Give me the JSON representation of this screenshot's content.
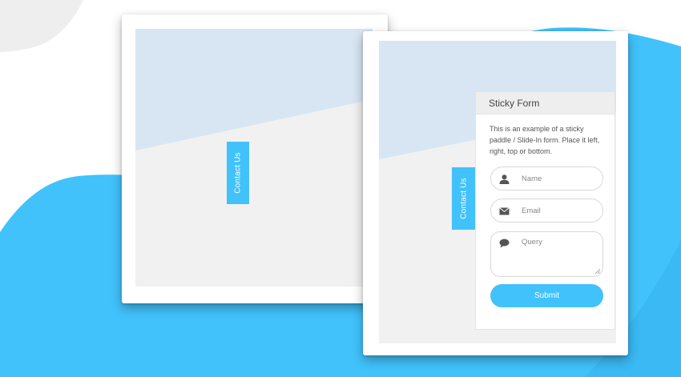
{
  "colors": {
    "accent": "#41c2fb",
    "background_blob": "#41c2fb",
    "decor_blob": "#eeeeee",
    "screen_top": "#d7e6f2",
    "screen_bottom": "#f1f1f1"
  },
  "preview_left": {
    "tab_label": "Contact Us"
  },
  "preview_right": {
    "tab_label": "Contact Us",
    "form": {
      "title": "Sticky Form",
      "description": "This is an example of a sticky paddle / Slide-In form. Place it left, right, top or bottom.",
      "fields": [
        {
          "icon": "user-icon",
          "placeholder": "Name"
        },
        {
          "icon": "envelope-icon",
          "placeholder": "Email"
        },
        {
          "icon": "speech-bubble-icon",
          "placeholder": "Query"
        }
      ],
      "submit_label": "Submit"
    }
  }
}
